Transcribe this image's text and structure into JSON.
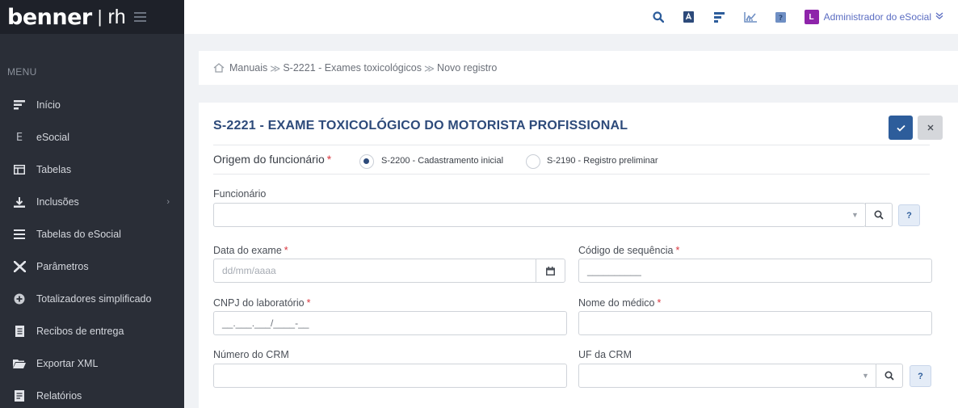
{
  "app": {
    "logo": "benner",
    "logo_separator": "|",
    "logo_suffix": "rh"
  },
  "sidebar": {
    "menu_title": "MENU",
    "items": [
      {
        "label": "Início",
        "icon": "dashboard-icon"
      },
      {
        "label": "eSocial",
        "icon": "esocial-letter-icon",
        "icon_glyph": "E"
      },
      {
        "label": "Tabelas",
        "icon": "table-icon"
      },
      {
        "label": "Inclusões",
        "icon": "download-icon",
        "has_submenu": true
      },
      {
        "label": "Tabelas do eSocial",
        "icon": "list-icon"
      },
      {
        "label": "Parâmetros",
        "icon": "tools-icon"
      },
      {
        "label": "Totalizadores simplificado",
        "icon": "plus-circle-icon"
      },
      {
        "label": "Recibos de entrega",
        "icon": "document-icon"
      },
      {
        "label": "Exportar XML",
        "icon": "folder-icon"
      },
      {
        "label": "Relatórios",
        "icon": "report-icon"
      }
    ]
  },
  "topbar": {
    "icons": [
      "search-icon",
      "text-format-icon",
      "menu-lines-icon",
      "chart-icon",
      "help-icon"
    ],
    "user_initial": "L",
    "user_name": "Administrador do eSocial",
    "user_color": "#8e24aa"
  },
  "breadcrumb": {
    "items": [
      "Manuais",
      "S-2221 - Exames toxicológicos",
      "Novo registro"
    ],
    "separator": "≫"
  },
  "form": {
    "title": "S-2221 - EXAME TOXICOLÓGICO DO MOTORISTA PROFISSIONAL",
    "origin_label": "Origem do funcionário",
    "required_mark": "*",
    "origin_options": [
      {
        "label": "S-2200 - Cadastramento inicial",
        "selected": true
      },
      {
        "label": "S-2190 - Registro preliminar",
        "selected": false
      }
    ],
    "funcionario_label": "Funcionário",
    "funcionario_value": "",
    "data_exame_label": "Data do exame",
    "data_exame_placeholder": "dd/mm/aaaa",
    "codigo_label": "Código de sequência",
    "codigo_value": "__________",
    "cnpj_label": "CNPJ do laboratório",
    "cnpj_value": "__.___.___/____-__",
    "medico_label": "Nome do médico",
    "medico_value": "",
    "crm_label": "Número do CRM",
    "crm_value": "",
    "uf_label": "UF da CRM",
    "uf_value": "",
    "help_text": "?"
  },
  "colors": {
    "primary": "#2d5d9b",
    "title": "#2d4a7a",
    "required": "#d9363e",
    "sidebar_bg": "#2a2e37"
  }
}
